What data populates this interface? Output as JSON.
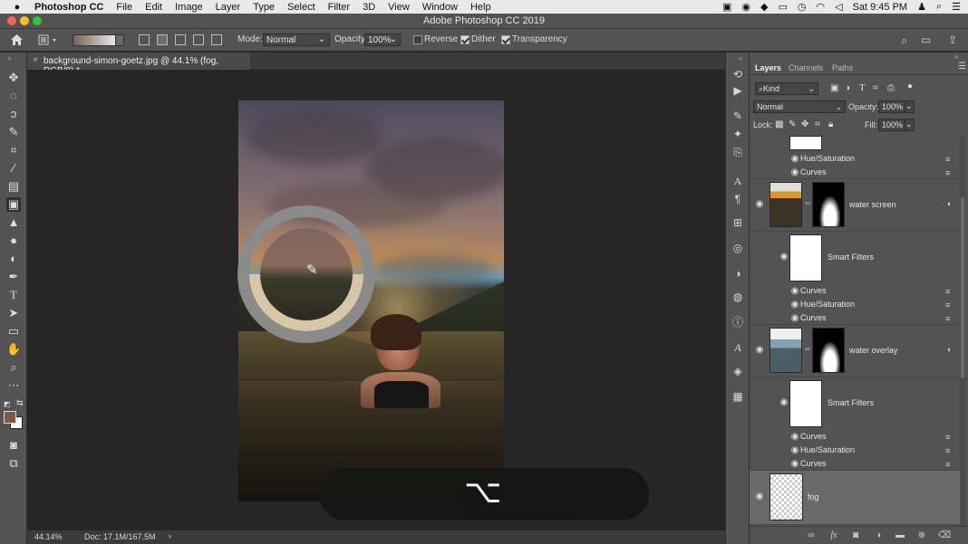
{
  "menubar": {
    "app_name": "Photoshop CC",
    "menus": [
      "File",
      "Edit",
      "Image",
      "Layer",
      "Type",
      "Select",
      "Filter",
      "3D",
      "View",
      "Window",
      "Help"
    ],
    "clock": "Sat 9:45 PM"
  },
  "window": {
    "title": "Adobe Photoshop CC 2019"
  },
  "options": {
    "mode_label": "Mode:",
    "mode_value": "Normal",
    "opacity_label": "Opacity:",
    "opacity_value": "100%",
    "reverse_label": "Reverse",
    "reverse_checked": false,
    "dither_label": "Dither",
    "dither_checked": true,
    "transparency_label": "Transparency",
    "transparency_checked": true
  },
  "document": {
    "tab_label": "background-simon-goetz.jpg @ 44.1% (fog, RGB/8) *",
    "close_glyph": "×",
    "hud_key": "⌥"
  },
  "status": {
    "zoom": "44.14%",
    "doc": "Doc: 17.1M/167.5M",
    "arrow": "›"
  },
  "panel": {
    "tabs": [
      "Layers",
      "Channels",
      "Paths"
    ],
    "filter_kind": "Kind",
    "blend_mode": "Normal",
    "opacity_label": "Opacity:",
    "opacity_value": "100%",
    "lock_label": "Lock:",
    "fill_label": "Fill:",
    "fill_value": "100%",
    "layers": [
      {
        "type": "filter",
        "name": "Hue/Saturation"
      },
      {
        "type": "filter",
        "name": "Curves"
      },
      {
        "type": "layer",
        "name": "water screen"
      },
      {
        "type": "smart",
        "name": "Smart Filters"
      },
      {
        "type": "filter",
        "name": "Curves"
      },
      {
        "type": "filter",
        "name": "Hue/Saturation"
      },
      {
        "type": "filter",
        "name": "Curves"
      },
      {
        "type": "layer",
        "name": "water overlay"
      },
      {
        "type": "smart",
        "name": "Smart Filters"
      },
      {
        "type": "filter",
        "name": "Curves"
      },
      {
        "type": "filter",
        "name": "Hue/Saturation"
      },
      {
        "type": "filter",
        "name": "Curves"
      },
      {
        "type": "layer",
        "name": "fog",
        "selected": true
      }
    ]
  },
  "colors": {
    "foreground": "#7a5a46",
    "background": "#ffffff",
    "panel_bg": "#535353",
    "canvas_bg": "#262626",
    "selected_layer": "#6a6a6a"
  }
}
